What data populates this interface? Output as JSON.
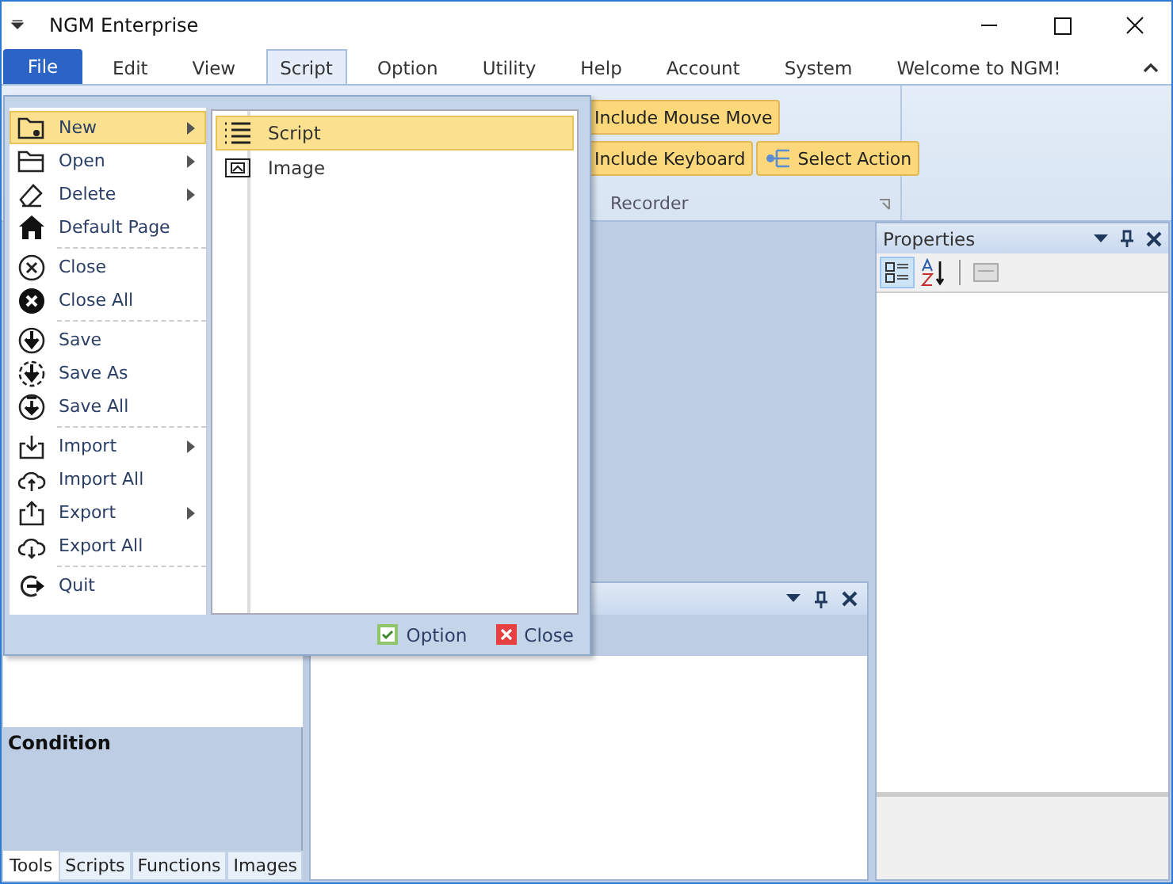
{
  "window": {
    "title": "NGM Enterprise"
  },
  "menu_tabs": [
    {
      "label": "File",
      "kind": "file",
      "selected": false
    },
    {
      "label": "Edit",
      "kind": "tab",
      "selected": false
    },
    {
      "label": "View",
      "kind": "tab",
      "selected": false
    },
    {
      "label": "Script",
      "kind": "tab",
      "selected": true
    },
    {
      "label": "Option",
      "kind": "tab",
      "selected": false
    },
    {
      "label": "Utility",
      "kind": "tab",
      "selected": false
    },
    {
      "label": "Help",
      "kind": "tab",
      "selected": false
    },
    {
      "label": "Account",
      "kind": "tab",
      "selected": false
    },
    {
      "label": "System",
      "kind": "tab",
      "selected": false
    },
    {
      "label": "Welcome to NGM!",
      "kind": "tab",
      "selected": false
    }
  ],
  "ribbon": {
    "buttons": [
      {
        "label": "Include Mouse Move"
      },
      {
        "label": "Include Keyboard"
      },
      {
        "label": "Select Action"
      }
    ],
    "group": "Recorder"
  },
  "file_menu": {
    "items": [
      {
        "kind": "item",
        "label": "New",
        "submenu": true,
        "selected": true
      },
      {
        "kind": "item",
        "label": "Open",
        "submenu": true,
        "selected": false
      },
      {
        "kind": "item",
        "label": "Delete",
        "submenu": true,
        "selected": false
      },
      {
        "kind": "item",
        "label": "Default Page",
        "submenu": false,
        "selected": false
      },
      {
        "kind": "separator"
      },
      {
        "kind": "item",
        "label": "Close",
        "submenu": false,
        "selected": false
      },
      {
        "kind": "item",
        "label": "Close All",
        "submenu": false,
        "selected": false
      },
      {
        "kind": "separator"
      },
      {
        "kind": "item",
        "label": "Save",
        "submenu": false,
        "selected": false
      },
      {
        "kind": "item",
        "label": "Save As",
        "submenu": false,
        "selected": false
      },
      {
        "kind": "item",
        "label": "Save All",
        "submenu": false,
        "selected": false
      },
      {
        "kind": "separator"
      },
      {
        "kind": "item",
        "label": "Import",
        "submenu": true,
        "selected": false
      },
      {
        "kind": "item",
        "label": "Import All",
        "submenu": false,
        "selected": false
      },
      {
        "kind": "item",
        "label": "Export",
        "submenu": true,
        "selected": false
      },
      {
        "kind": "item",
        "label": "Export All",
        "submenu": false,
        "selected": false
      },
      {
        "kind": "separator"
      },
      {
        "kind": "item",
        "label": "Quit",
        "submenu": false,
        "selected": false
      }
    ],
    "submenu": [
      {
        "label": "Script",
        "selected": true
      },
      {
        "label": "Image",
        "selected": false
      }
    ],
    "footer": [
      {
        "label": "Option",
        "kind": "ok"
      },
      {
        "label": "Close",
        "kind": "cancel"
      }
    ]
  },
  "left_panel": {
    "heading": "Condition",
    "tabs": [
      {
        "label": "Tools",
        "selected": true
      },
      {
        "label": "Scripts",
        "selected": false
      },
      {
        "label": "Functions",
        "selected": false
      },
      {
        "label": "Images",
        "selected": false
      }
    ]
  },
  "properties": {
    "title": "Properties"
  }
}
